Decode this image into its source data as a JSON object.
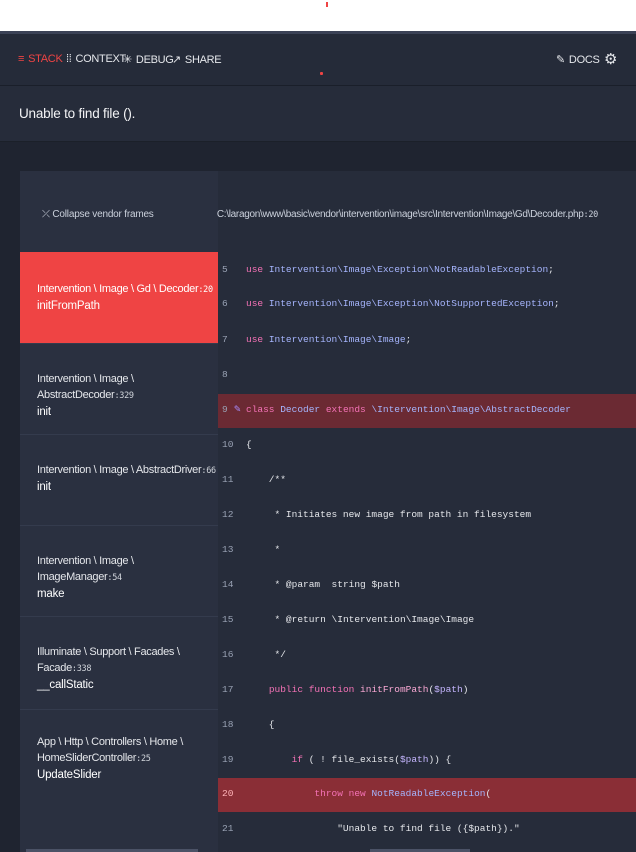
{
  "nav": {
    "items": [
      {
        "icon": "≡",
        "label": "STACK"
      },
      {
        "icon": "⁞⁞",
        "label": "CONTEXT"
      },
      {
        "icon": "✳",
        "label": "DEBUG"
      },
      {
        "icon": "↗",
        "label": "SHARE"
      }
    ],
    "docs_label": "DOCS",
    "accent": "#ef4444"
  },
  "error": {
    "message": "Unable to find file ()."
  },
  "frames": {
    "collapse_label": "Collapse vendor frames",
    "items": [
      {
        "cls": "Intervention \\ Image \\ Gd \\ Decoder",
        "line": ":20",
        "fn": "initFromPath"
      },
      {
        "cls": "Intervention \\ Image \\ AbstractDecoder",
        "line": ":329",
        "fn": "init"
      },
      {
        "cls": "Intervention \\ Image \\ AbstractDriver",
        "line": ":66",
        "fn": "init"
      },
      {
        "cls": "Intervention \\ Image \\ ImageManager",
        "line": ":54",
        "fn": "make"
      },
      {
        "cls": "Illuminate \\ Support \\ Facades \\ Facade",
        "line": ":338",
        "fn": "__callStatic"
      },
      {
        "cls": "App \\ Http \\ Controllers \\ Home \\ HomeSliderController",
        "line": ":25",
        "fn": "UpdateSlider"
      }
    ]
  },
  "code": {
    "file": "C:\\laragon\\www\\basic\\vendor\\intervention\\image\\src\\Intervention\\Image\\Gd\\Decoder.php",
    "file_line": ":20",
    "lines": [
      {
        "n": "5",
        "text": "use Intervention\\Image\\Exception\\NotReadableException;"
      },
      {
        "n": "6",
        "text": "use Intervention\\Image\\Exception\\NotSupportedException;"
      },
      {
        "n": "7",
        "text": "use Intervention\\Image\\Image;"
      },
      {
        "n": "8",
        "text": ""
      },
      {
        "n": "9",
        "text": "class Decoder extends \\Intervention\\Image\\AbstractDecoder"
      },
      {
        "n": "10",
        "text": "{"
      },
      {
        "n": "11",
        "text": "    /**"
      },
      {
        "n": "12",
        "text": "     * Initiates new image from path in filesystem"
      },
      {
        "n": "13",
        "text": "     *"
      },
      {
        "n": "14",
        "text": "     * @param  string $path"
      },
      {
        "n": "15",
        "text": "     * @return \\Intervention\\Image\\Image"
      },
      {
        "n": "16",
        "text": "     */"
      },
      {
        "n": "17",
        "text": "    public function initFromPath($path)"
      },
      {
        "n": "18",
        "text": "    {"
      },
      {
        "n": "19",
        "text": "        if ( ! file_exists($path)) {"
      },
      {
        "n": "20",
        "text": "            throw new NotReadableException("
      },
      {
        "n": "21",
        "text": "                \"Unable to find file ({$path}).\""
      }
    ]
  }
}
